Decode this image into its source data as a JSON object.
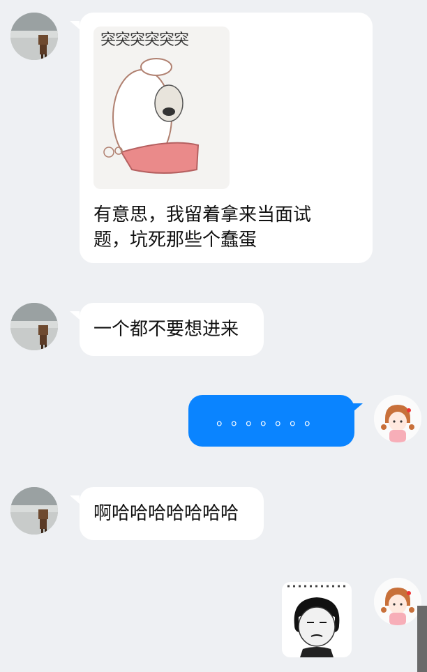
{
  "messages": [
    {
      "sender": "other",
      "sticker_caption": "突突突突突突",
      "text": "有意思，我留着拿来当面试题，坑死那些个蠢蛋"
    },
    {
      "sender": "other",
      "text": "一个都不要想进来"
    },
    {
      "sender": "me",
      "text": "。。。。。。。"
    },
    {
      "sender": "other",
      "text": "啊哈哈哈哈哈哈哈"
    },
    {
      "sender": "me",
      "sticker": "meme-face-sticker"
    }
  ],
  "colors": {
    "background": "#eef0f3",
    "incoming_bubble": "#ffffff",
    "outgoing_bubble": "#0a84ff"
  }
}
